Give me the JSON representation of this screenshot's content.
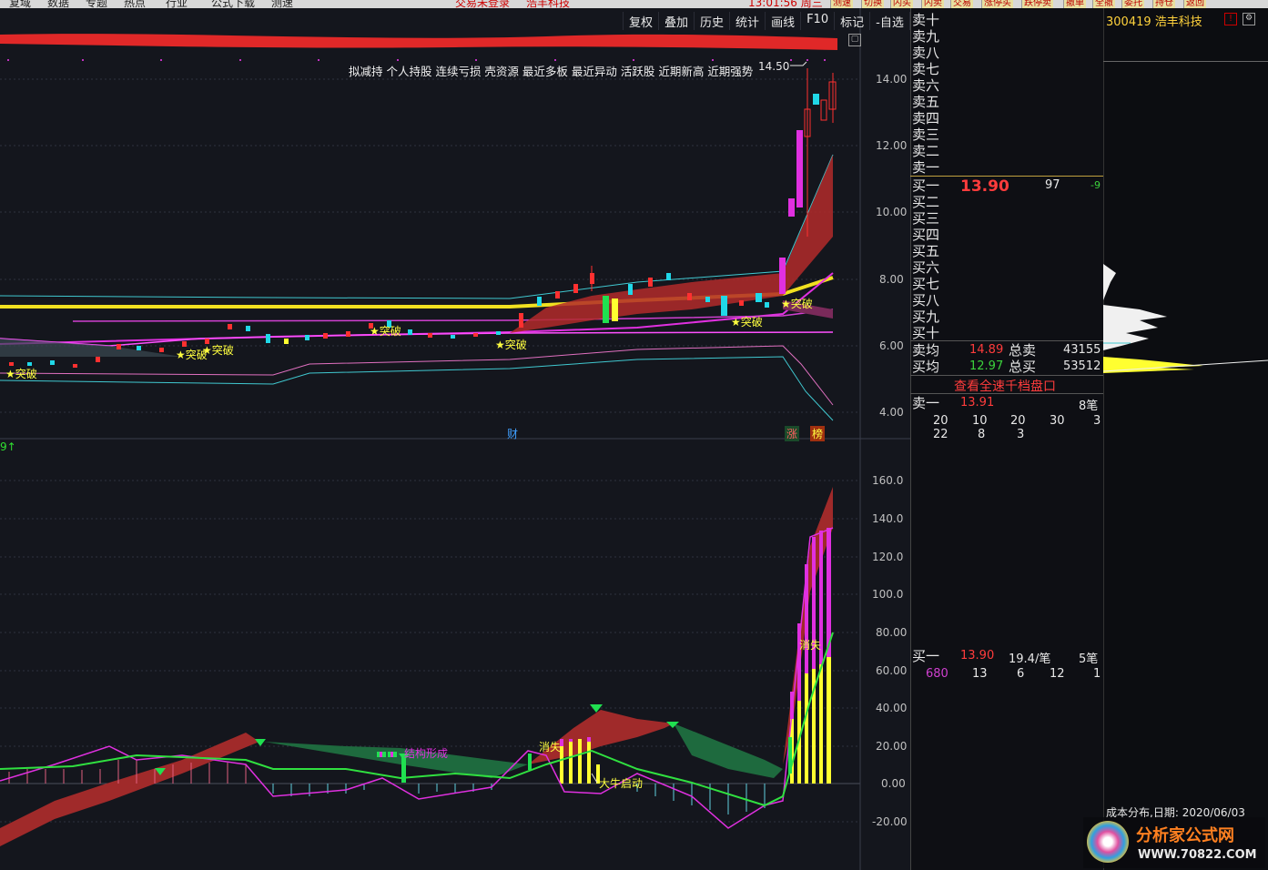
{
  "top_menu": {
    "items": [
      "复域",
      "数据",
      "专题",
      "热点",
      "行业",
      "公式下载",
      "测速"
    ],
    "center_status": "交易未登录",
    "center_stock": "浩丰科技",
    "clock": "13:01:56 周三",
    "trade_buttons": [
      "测速",
      "切换",
      "闪买",
      "闪卖",
      "交易",
      "涨停买",
      "跌停卖",
      "撤单",
      "全撤",
      "委托",
      "持仓",
      "返回"
    ]
  },
  "chart_toolbar": [
    "复权",
    "叠加",
    "历史",
    "统计",
    "画线",
    "F10",
    "标记",
    "-自选",
    "返回"
  ],
  "indicator_names": "拟减持 个人持股 连续亏损 壳资源 最近多板 最近异动 活跃股 近期新高 近期强势",
  "price_high_label": "14.50",
  "price_axis": [
    "14.00",
    "12.00",
    "10.00",
    "8.00",
    "6.00",
    "4.00"
  ],
  "osc_axis": [
    "160.0",
    "140.0",
    "120.0",
    "100.0",
    "80.00",
    "60.00",
    "40.00",
    "20.00",
    "0.00",
    "-20.00"
  ],
  "breakout_label": "★突破",
  "event_labels": {
    "cai": "财",
    "zhangting": "涨",
    "bang": "榜"
  },
  "osc_labels": {
    "jiegou": "结构形成",
    "xiaoshi1": "消失",
    "xiaoshi2": "消失",
    "daniu": "大牛启动",
    "top_marker": "9↑"
  },
  "stock": {
    "code": "300419",
    "name": "浩丰科技"
  },
  "orderbook": {
    "sells": [
      "卖十",
      "卖九",
      "卖八",
      "卖七",
      "卖六",
      "卖五",
      "卖四",
      "卖三",
      "卖二",
      "卖一"
    ],
    "buys": [
      "买一",
      "买二",
      "买三",
      "买四",
      "买五",
      "买六",
      "买七",
      "买八",
      "买九",
      "买十"
    ],
    "buy1_price": "13.90",
    "buy1_vol": "97",
    "buy1_change": "-9",
    "sell_avg_label": "卖均",
    "sell_avg": "14.89",
    "total_sell_label": "总卖",
    "total_sell": "43155",
    "buy_avg_label": "买均",
    "buy_avg": "12.97",
    "total_buy_label": "总买",
    "total_buy": "53512",
    "link": "查看全速千档盘口"
  },
  "queue": {
    "sell1_label": "卖一",
    "sell1_price": "13.91",
    "sell1_count": "8笔",
    "sell1_row1": [
      "20",
      "10",
      "20",
      "30",
      "3"
    ],
    "sell1_row2": [
      "22",
      "8",
      "3"
    ],
    "buy1_label": "买一",
    "buy1_price": "13.90",
    "buy1_avg": "19.4/笔",
    "buy1_count": "5笔",
    "buy1_row": [
      "680",
      "13",
      "6",
      "12",
      "1"
    ]
  },
  "cost_dist": {
    "label": "成本分布,日期:",
    "date": "2020/06/03"
  },
  "watermark": {
    "brand": "分析家公式网",
    "url": "WWW.70822.COM"
  }
}
